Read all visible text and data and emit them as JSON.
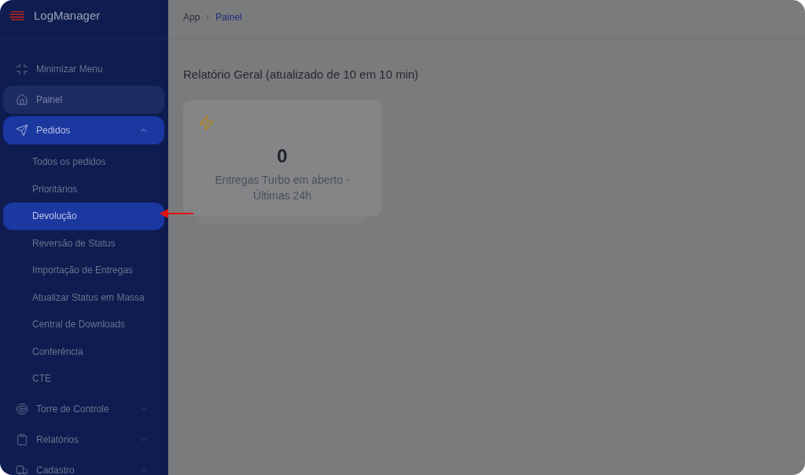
{
  "app": {
    "name": "LogManager"
  },
  "sidebar": {
    "items": [
      {
        "kind": "toggle",
        "label": "Minimizar Menu",
        "selected": false
      },
      {
        "kind": "link",
        "label": "Painel",
        "selected": true
      },
      {
        "kind": "group",
        "label": "Pedidos",
        "selected": false,
        "expanded": true,
        "children": [
          {
            "label": "Todos os pedidos",
            "selected": false
          },
          {
            "label": "Prioritários",
            "selected": false
          },
          {
            "label": "Devolução",
            "selected": true
          },
          {
            "label": "Reversão de Status",
            "selected": false
          },
          {
            "label": "Importação de Entregas",
            "selected": false
          },
          {
            "label": "Atualizar Status em Massa",
            "selected": false
          },
          {
            "label": "Central de Downloads",
            "selected": false
          },
          {
            "label": "Conferência",
            "selected": false
          },
          {
            "label": "CTE",
            "selected": false
          }
        ]
      },
      {
        "kind": "group",
        "label": "Torre de Controle",
        "selected": false,
        "expanded": false
      },
      {
        "kind": "group",
        "label": "Relatórios",
        "selected": false,
        "expanded": false
      },
      {
        "kind": "group",
        "label": "Cadastro",
        "selected": false,
        "expanded": false
      }
    ]
  },
  "breadcrumb": [
    {
      "label": "App",
      "selected": false
    },
    {
      "label": "Painel",
      "selected": true
    }
  ],
  "page": {
    "title": "Relatório Geral (atualizado de 10 em 10 min)"
  },
  "cards": [
    {
      "value": "0",
      "label": "Entregas Turbo em aberto - Últimas 24h"
    }
  ]
}
